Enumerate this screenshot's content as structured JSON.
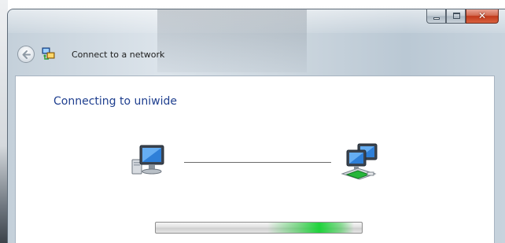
{
  "window": {
    "title": "Connect to a network",
    "caption_buttons": {
      "minimize": "minimize",
      "maximize": "maximize",
      "close": "✕"
    }
  },
  "content": {
    "heading": "Connecting to uniwide"
  },
  "progress": {
    "mode": "indeterminate",
    "glow_position": 0.75
  },
  "icons": {
    "back": "back-arrow-icon",
    "network": "network-connect-icon",
    "local_computer": "computer-icon",
    "network_computers": "network-computers-icon"
  },
  "colors": {
    "heading": "#1f3f8f",
    "progress_glow": "#14d232",
    "close_button": "#c1391b"
  }
}
